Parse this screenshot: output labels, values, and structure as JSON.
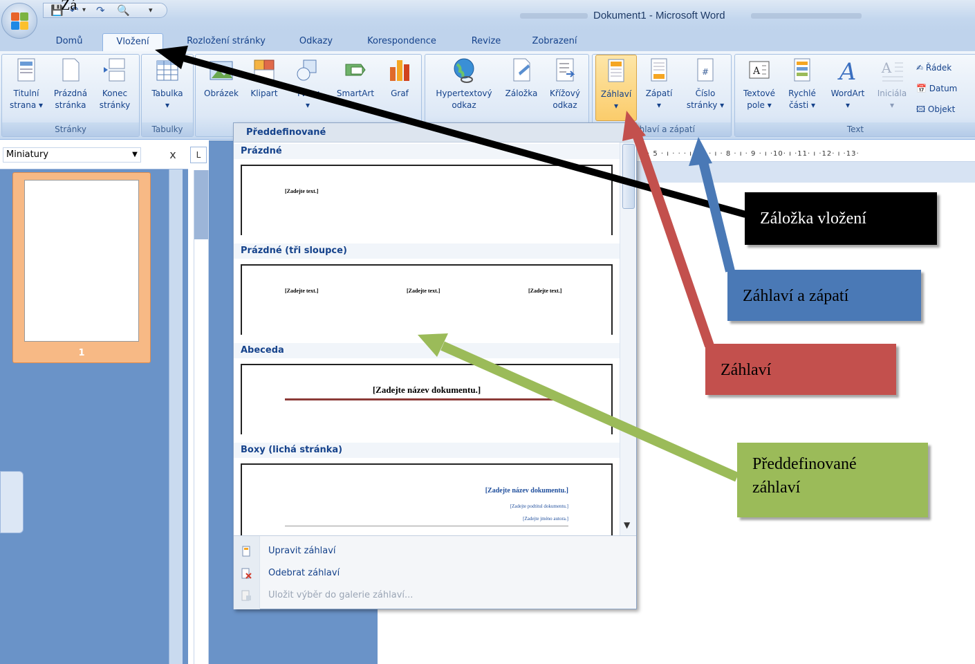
{
  "window": {
    "title": "Dokument1 - Microsoft Word",
    "stray_text": "Zá"
  },
  "tabs": [
    "Domů",
    "Vložení",
    "Rozložení stránky",
    "Odkazy",
    "Korespondence",
    "Revize",
    "Zobrazení"
  ],
  "active_tab": "Vložení",
  "ribbon": {
    "groups": {
      "pages": {
        "label": "Stránky",
        "buttons": [
          {
            "line1": "Titulní",
            "line2": "strana ▾"
          },
          {
            "line1": "Prázdná",
            "line2": "stránka"
          },
          {
            "line1": "Konec",
            "line2": "stránky"
          }
        ]
      },
      "tables": {
        "label": "Tabulky",
        "button": {
          "line1": "Tabulka",
          "line2": "▾"
        }
      },
      "illustrations": {
        "buttons": [
          {
            "line1": "Obrázek"
          },
          {
            "line1": "Klipart"
          },
          {
            "line1": "Tvary",
            "line2": "▾"
          },
          {
            "line1": "SmartArt"
          },
          {
            "line1": "Graf"
          }
        ]
      },
      "links": {
        "buttons": [
          {
            "line1": "Hypertextový",
            "line2": "odkaz"
          },
          {
            "line1": "Záložka"
          },
          {
            "line1": "Křížový",
            "line2": "odkaz"
          }
        ]
      },
      "header_footer": {
        "label": "Záhlaví a zápatí",
        "buttons": [
          {
            "line1": "Záhlaví",
            "line2": "▾"
          },
          {
            "line1": "Zápatí",
            "line2": "▾"
          },
          {
            "line1": "Číslo",
            "line2": "stránky ▾"
          }
        ]
      },
      "text": {
        "label": "Text",
        "buttons": [
          {
            "line1": "Textové",
            "line2": "pole ▾"
          },
          {
            "line1": "Rychlé",
            "line2": "části ▾"
          },
          {
            "line1": "WordArt",
            "line2": "▾"
          },
          {
            "line1": "Iniciála",
            "line2": "▾"
          }
        ],
        "small_buttons": [
          "Řádek",
          "Datum",
          "Objekt"
        ]
      }
    }
  },
  "left_pane": {
    "selector_value": "Miniatury",
    "close_label": "x",
    "thumbnail_page_number": "1"
  },
  "ruler": {
    "corner_label": "L",
    "horizontal_ticks": "· 5 · ı · · · ı · 7 · ı · 8 · ı · 9 · ı ·10· ı ·11· ı ·12· ı ·13·"
  },
  "gallery": {
    "header": "Předdefinované",
    "items": [
      {
        "title": "Prázdné",
        "placeholders": [
          "[Zadejte text.]"
        ]
      },
      {
        "title": "Prázdné (tři sloupce)",
        "placeholders": [
          "[Zadejte text.]",
          "[Zadejte text.]",
          "[Zadejte text.]"
        ]
      },
      {
        "title": "Abeceda",
        "placeholders": [
          "[Zadejte název dokumentu.]"
        ]
      },
      {
        "title": "Boxy (lichá stránka)",
        "placeholders": [
          "[Zadejte název dokumentu.]",
          "[Zadejte podtitul dokumentu.]",
          "[Zadejte jméno autora.]"
        ]
      }
    ],
    "menu": [
      {
        "label": "Upravit záhlaví",
        "enabled": true
      },
      {
        "label": "Odebrat záhlaví",
        "enabled": true
      },
      {
        "label": "Uložit výběr do galerie záhlaví...",
        "enabled": false
      }
    ]
  },
  "callouts": {
    "vlozeni": {
      "text": "Záložka vložení",
      "color": "#000000"
    },
    "zahlavi_zapati": {
      "text": "Záhlaví a zápatí",
      "color": "#4a79b6"
    },
    "zahlavi": {
      "text": "Záhlaví",
      "color": "#c3504d"
    },
    "predefinovane": {
      "line1": "Předdefinované",
      "line2": "záhlaví",
      "color": "#9bbb59"
    }
  },
  "colors": {
    "ribbon_blue": "#dbe7f5",
    "tab_text": "#15428b",
    "pressed_button": "#fbcc6b",
    "thumb_selected": "#f7b985"
  }
}
